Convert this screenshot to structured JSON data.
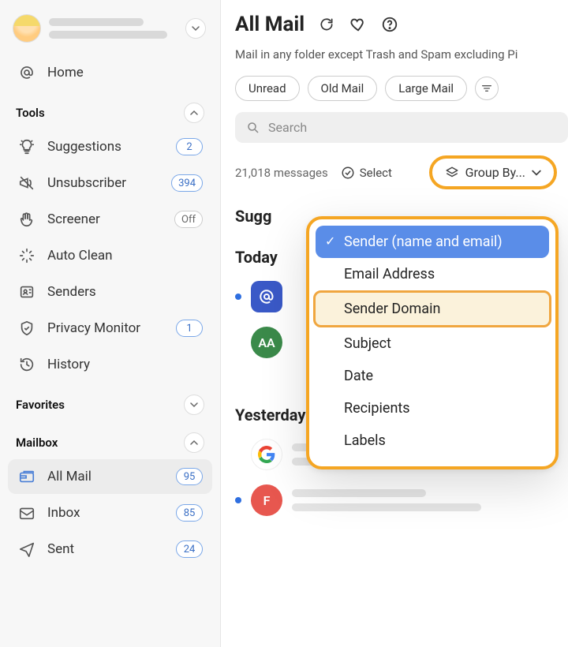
{
  "sidebar": {
    "home_label": "Home",
    "sections": {
      "tools_label": "Tools",
      "favorites_label": "Favorites",
      "mailbox_label": "Mailbox"
    },
    "tools": [
      {
        "label": "Suggestions",
        "badge": "2",
        "icon": "bulb"
      },
      {
        "label": "Unsubscriber",
        "badge": "394",
        "icon": "megaphone-off"
      },
      {
        "label": "Screener",
        "badge": "Off",
        "badge_style": "gray",
        "icon": "hand"
      },
      {
        "label": "Auto Clean",
        "badge": "",
        "icon": "auto-clean"
      },
      {
        "label": "Senders",
        "badge": "",
        "icon": "contact-card"
      },
      {
        "label": "Privacy Monitor",
        "badge": "1",
        "icon": "shield"
      },
      {
        "label": "History",
        "badge": "",
        "icon": "history"
      }
    ],
    "mailbox": [
      {
        "label": "All Mail",
        "badge": "95",
        "icon": "all-mail",
        "active": true
      },
      {
        "label": "Inbox",
        "badge": "85",
        "icon": "inbox"
      },
      {
        "label": "Sent",
        "badge": "24",
        "icon": "sent"
      }
    ]
  },
  "header": {
    "title": "All Mail",
    "description": "Mail in any folder except Trash and Spam excluding Pi"
  },
  "filters": {
    "unread": "Unread",
    "old_mail": "Old Mail",
    "large_mail": "Large Mail"
  },
  "search": {
    "placeholder": "Search"
  },
  "toolbar": {
    "message_count": "21,018 messages",
    "select_label": "Select",
    "group_by_label": "Group By..."
  },
  "groupby_menu": {
    "options": [
      "Sender (name and email)",
      "Email Address",
      "Sender Domain",
      "Subject",
      "Date",
      "Recipients",
      "Labels"
    ],
    "selected_index": 0,
    "highlighted_index": 2
  },
  "content": {
    "suggested": "Sugg",
    "today": "Today",
    "yesterday": "Yesterday",
    "avatars": {
      "aa_initials": "AA",
      "f_initial": "F"
    }
  }
}
